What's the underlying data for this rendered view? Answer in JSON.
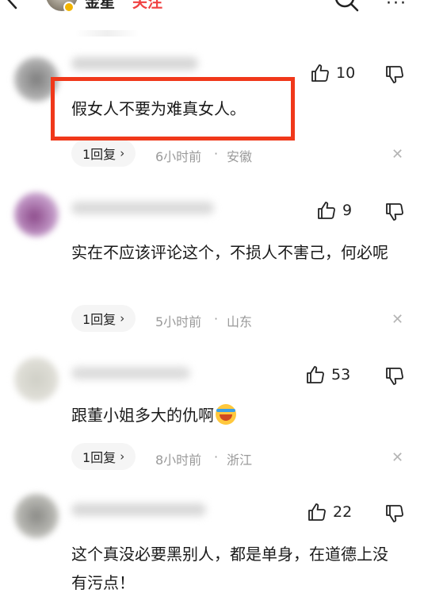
{
  "header": {
    "author_name": "金星",
    "follow_label": "关注",
    "more_label": "···"
  },
  "comments": [
    {
      "likes": "10",
      "text": "假女人不要为难真女人。",
      "reply_label": "1回复",
      "time": "6小时前",
      "separator": "·",
      "location": "安徽",
      "highlighted": true
    },
    {
      "likes": "9",
      "text": "实在不应该评论这个，不损人不害己，何必呢",
      "reply_label": "1回复",
      "time": "5小时前",
      "separator": "·",
      "location": "山东"
    },
    {
      "likes": "53",
      "text": "跟董小姐多大的仇啊",
      "emoji": "crying-laughing-emoji",
      "reply_label": "1回复",
      "time": "8小时前",
      "separator": "·",
      "location": "浙江"
    },
    {
      "likes": "22",
      "text": "这个真没必要黑别人，都是单身，在道德上没有污点！"
    }
  ],
  "colors": {
    "highlight_border": "#f0381a",
    "follow_red": "#f04142",
    "meta_gray": "#9a9a9a"
  }
}
